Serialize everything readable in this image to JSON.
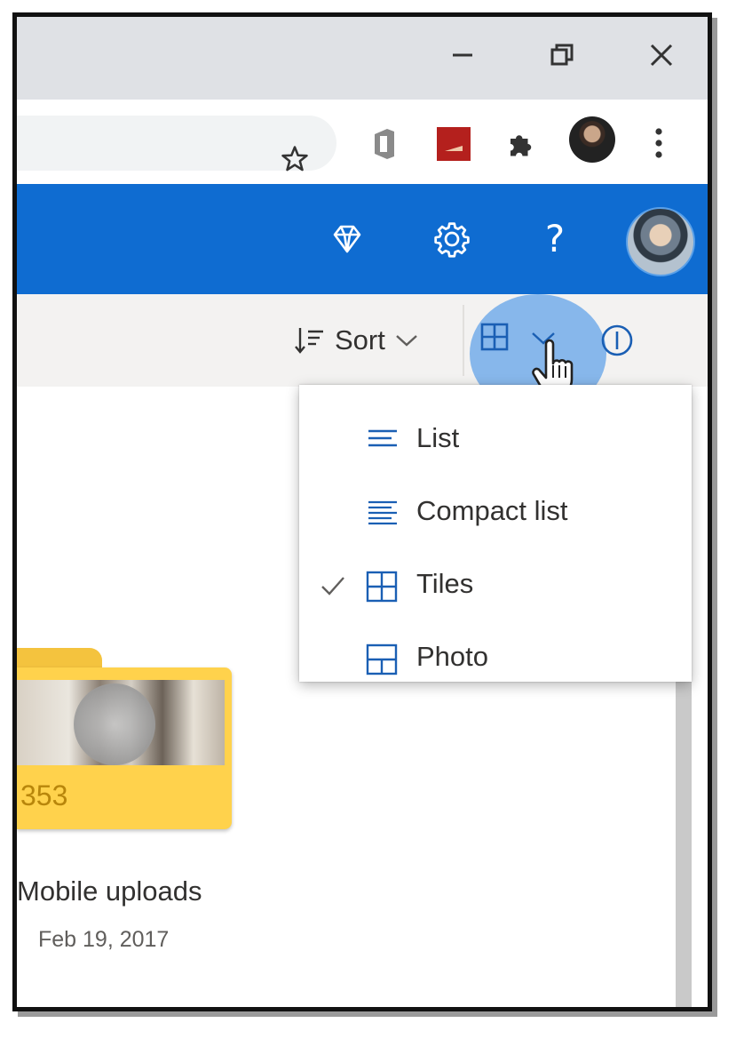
{
  "browser": {
    "minimize_icon": "minimize-icon",
    "restore_icon": "restore-icon",
    "close_icon": "close-icon",
    "bookmark_icon": "star-icon",
    "extensions": [
      "office-extension-icon",
      "red-extension-icon",
      "puzzle-extensions-icon"
    ],
    "menu_icon": "kebab-menu-icon"
  },
  "app_header": {
    "premium_icon": "diamond-icon",
    "settings_icon": "gear-icon",
    "help_label": "?"
  },
  "command_bar": {
    "sort_label": "Sort",
    "view_icon": "tiles-grid-icon",
    "info_icon": "info-icon"
  },
  "view_menu": {
    "items": [
      {
        "label": "List",
        "icon": "list-icon",
        "checked": false
      },
      {
        "label": "Compact list",
        "icon": "compact-list-icon",
        "checked": false
      },
      {
        "label": "Tiles",
        "icon": "tiles-icon",
        "checked": true
      },
      {
        "label": "Photo",
        "icon": "photo-icon",
        "checked": false
      }
    ]
  },
  "folders": [
    {
      "count": "353",
      "name": "Mobile uploads",
      "date": "Feb 19, 2017"
    }
  ],
  "colors": {
    "app_bar": "#0f6cd1",
    "folder": "#ffd24c",
    "highlight": "#2d87e6"
  }
}
